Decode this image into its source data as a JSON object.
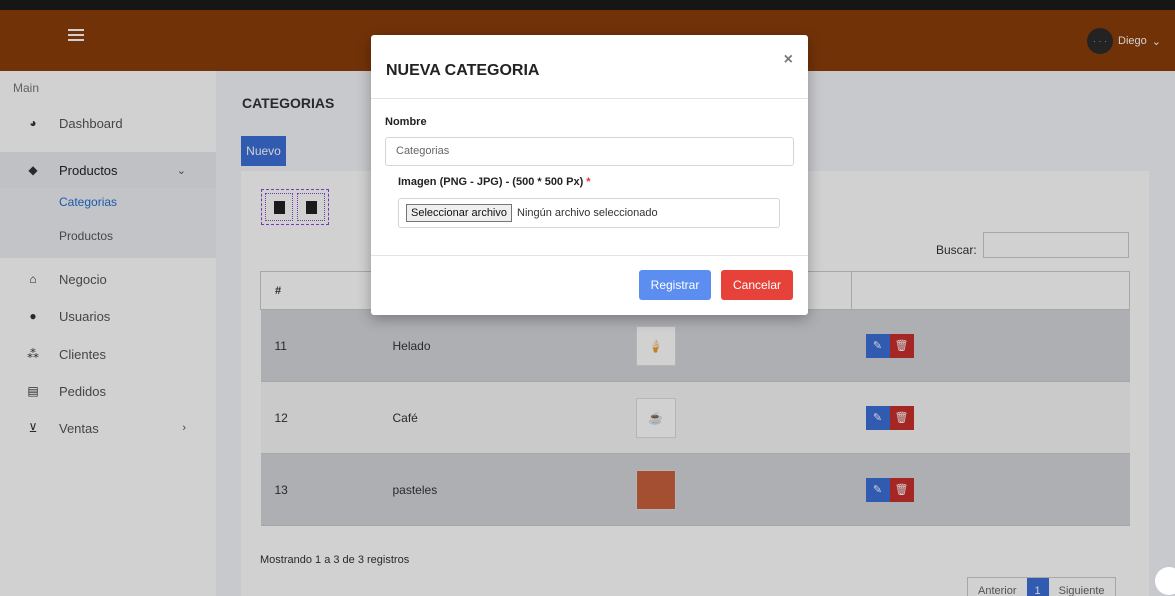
{
  "topbar": {
    "user_name": "Diego",
    "avatar_text": "· · ·"
  },
  "sidebar": {
    "section": "Main",
    "items": [
      {
        "label": "Dashboard",
        "icon": "pie-chart-icon"
      },
      {
        "label": "Productos",
        "icon": "tags-icon"
      },
      {
        "label": "Negocio",
        "icon": "home-icon"
      },
      {
        "label": "Usuarios",
        "icon": "user-icon"
      },
      {
        "label": "Clientes",
        "icon": "users-icon"
      },
      {
        "label": "Pedidos",
        "icon": "list-icon"
      },
      {
        "label": "Ventas",
        "icon": "cart-icon"
      }
    ],
    "sub_items": [
      {
        "label": "Categorias"
      },
      {
        "label": "Productos"
      }
    ]
  },
  "page": {
    "title": "CATEGORIAS",
    "nuevo_label": "Nuevo",
    "buscar_label": "Buscar:",
    "table": {
      "headers": [
        "#",
        "",
        "",
        ""
      ],
      "rows": [
        {
          "id": "11",
          "name": "Helado"
        },
        {
          "id": "12",
          "name": "Café"
        },
        {
          "id": "13",
          "name": "pasteles"
        }
      ]
    },
    "info": "Mostrando 1 a 3 de 3 registros",
    "pager": {
      "prev": "Anterior",
      "current": "1",
      "next": "Siguiente"
    }
  },
  "modal": {
    "title": "NUEVA CATEGORIA",
    "close": "×",
    "nombre_label": "Nombre",
    "nombre_value": "Categorias",
    "imagen_label": "Imagen (PNG - JPG) - (500 * 500 Px)",
    "required_mark": "*",
    "file_button": "Seleccionar archivo",
    "file_status": "Ningún archivo seleccionado",
    "registrar": "Registrar",
    "cancelar": "Cancelar"
  },
  "colors": {
    "topbar": "#8b3e0a",
    "primary": "#3c6fd8",
    "danger": "#e6423a"
  }
}
